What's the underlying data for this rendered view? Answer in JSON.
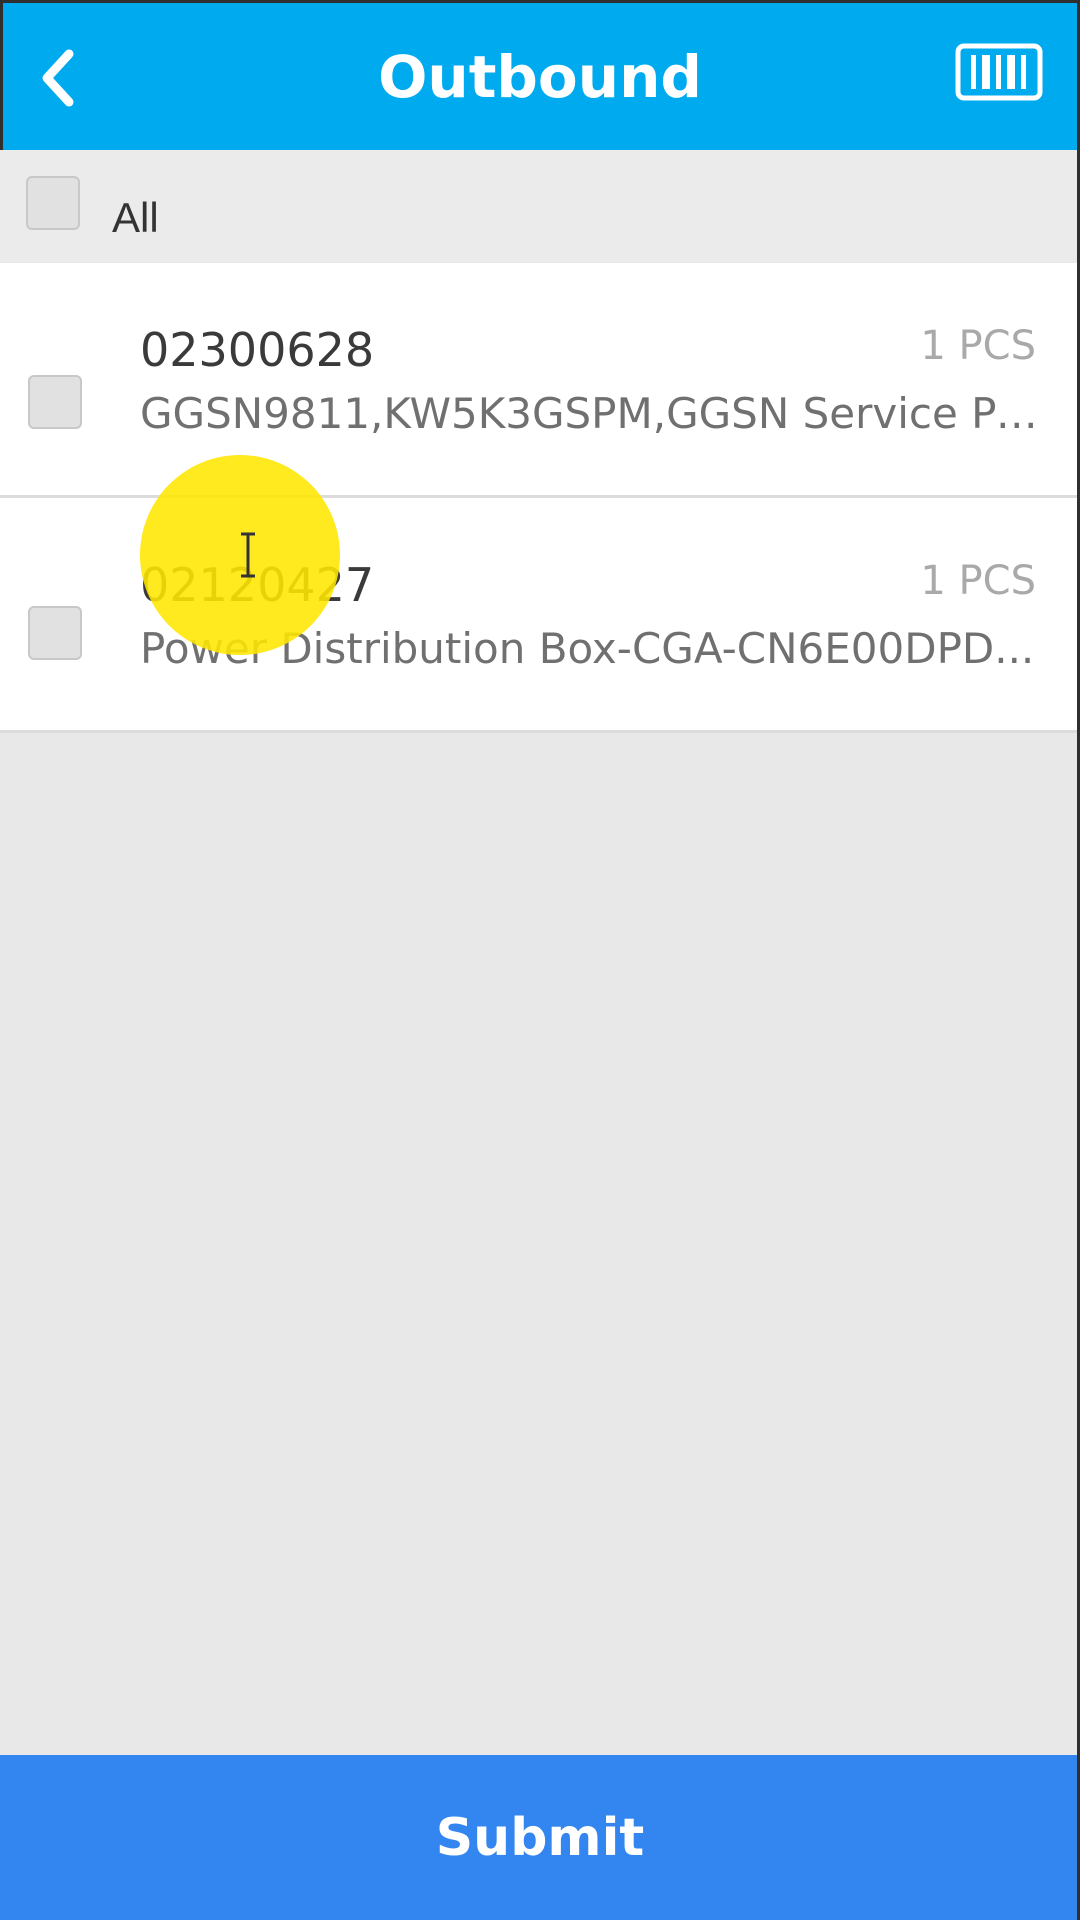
{
  "header": {
    "title": "Outbound",
    "back_icon": "chevron-left-icon",
    "scan_icon": "barcode-scan-icon",
    "background": "#00aaee"
  },
  "select_all": {
    "label": "All",
    "checked": false
  },
  "items": [
    {
      "code": "02300628",
      "quantity": "1 PCS",
      "description": "GGSN9811,KW5K3GSPM,GGSN Service Pr...",
      "checked": false
    },
    {
      "code": "02120427",
      "quantity": "1 PCS",
      "description": "Power Distribution Box-CGA-CN6E00DPD...",
      "checked": false
    }
  ],
  "footer": {
    "submit_label": "Submit",
    "background": "#3385ef"
  }
}
